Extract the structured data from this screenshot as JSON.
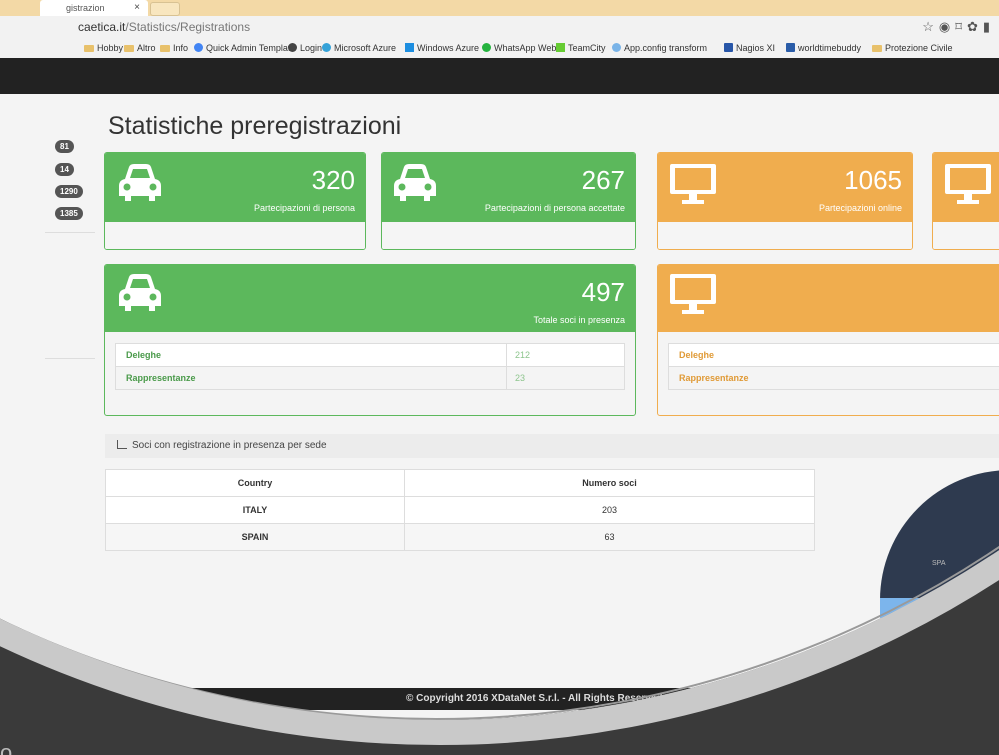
{
  "browser": {
    "tab_title": "gistrazion",
    "tab_close": "×",
    "url_host": "caetica.it",
    "url_path": "/Statistics/Registrations",
    "icons": "☆◉⌑✿▮"
  },
  "bookmarks": [
    {
      "label": "Hobby",
      "kind": "folder"
    },
    {
      "label": "Altro",
      "kind": "folder"
    },
    {
      "label": "Info",
      "kind": "folder"
    },
    {
      "label": "Quick Admin Templat",
      "kind": "google"
    },
    {
      "label": "Login",
      "kind": "site"
    },
    {
      "label": "Microsoft Azure",
      "kind": "azure"
    },
    {
      "label": "Windows Azure",
      "kind": "windows"
    },
    {
      "label": "WhatsApp Web",
      "kind": "whatsapp"
    },
    {
      "label": "TeamCity",
      "kind": "teamcity"
    },
    {
      "label": "App.config transform",
      "kind": "site"
    },
    {
      "label": "Nagios XI",
      "kind": "nagios"
    },
    {
      "label": "worldtimebuddy",
      "kind": "site"
    },
    {
      "label": "Protezione Civile",
      "kind": "folder"
    }
  ],
  "sidebar": {
    "badges": [
      "81",
      "14",
      "1290",
      "1385"
    ]
  },
  "page": {
    "title": "Statistiche preregistrazioni"
  },
  "cards": {
    "c1": {
      "value": "320",
      "label": "Partecipazioni di persona"
    },
    "c2": {
      "value": "267",
      "label": "Partecipazioni di persona accettate"
    },
    "c3": {
      "value": "1065",
      "label": "Partecipazioni online"
    },
    "total": {
      "value": "497",
      "label": "Totale soci in presenza"
    }
  },
  "presence_table": [
    {
      "key": "Deleghe",
      "value": "212"
    },
    {
      "key": "Rappresentanze",
      "value": "23"
    }
  ],
  "online_table": [
    {
      "key": "Deleghe"
    },
    {
      "key": "Rappresentanze"
    }
  ],
  "section": {
    "title": "Soci con registrazione in presenza per sede"
  },
  "sedi_table": {
    "headers": [
      "Country",
      "Numero soci"
    ],
    "rows": [
      {
        "country": "ITALY",
        "count": "203"
      },
      {
        "country": "SPAIN",
        "count": "63"
      }
    ]
  },
  "pie_label": "SPA",
  "footer": {
    "text": "© Copyright 2016 XDataNet S.r.l. - All Rights Reserved"
  },
  "corner_mark": "o",
  "colors": {
    "green": "#5cb85c",
    "orange": "#f0ad4e",
    "dark": "#222222"
  }
}
